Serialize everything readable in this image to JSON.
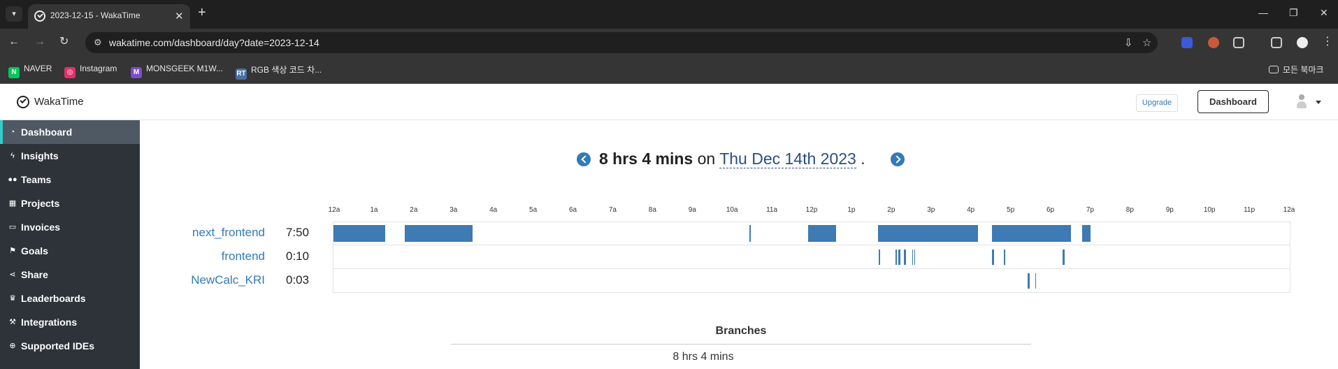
{
  "browser": {
    "tab_title": "2023-12-15 - WakaTime",
    "url": "wakatime.com/dashboard/day?date=2023-12-14",
    "bookmarks": [
      {
        "label": "NAVER",
        "icon": "naver-icon",
        "color": "#03c75a"
      },
      {
        "label": "Instagram",
        "icon": "instagram-icon",
        "color": "#e1306c"
      },
      {
        "label": "MONSGEEK M1W...",
        "icon": "monsgeek-icon",
        "color": "#7a4ccf"
      },
      {
        "label": "RGB 색상 코드 차...",
        "icon": "rt-icon",
        "color": "#4a6fa5"
      }
    ],
    "all_bookmarks": "모든 북마크"
  },
  "header": {
    "logo_text": "WakaTime",
    "upgrade_label": "Upgrade",
    "dashboard_label": "Dashboard"
  },
  "sidebar": {
    "items": [
      {
        "label": "Dashboard",
        "icon": "dashboard-icon",
        "active": true
      },
      {
        "label": "Insights",
        "icon": "bolt-icon"
      },
      {
        "label": "Teams",
        "icon": "users-icon"
      },
      {
        "label": "Projects",
        "icon": "grid-icon"
      },
      {
        "label": "Invoices",
        "icon": "file-icon"
      },
      {
        "label": "Goals",
        "icon": "flag-icon"
      },
      {
        "label": "Share",
        "icon": "share-icon"
      },
      {
        "label": "Leaderboards",
        "icon": "trophy-icon"
      },
      {
        "label": "Integrations",
        "icon": "wrench-icon"
      },
      {
        "label": "Supported IDEs",
        "icon": "plus-circle-icon"
      }
    ]
  },
  "summary": {
    "total": "8 hrs 4 mins",
    "on": "on",
    "date": "Thu Dec 14th 2023",
    "period": "."
  },
  "timeline": {
    "hours": [
      "12a",
      "1a",
      "2a",
      "3a",
      "4a",
      "5a",
      "6a",
      "7a",
      "8a",
      "9a",
      "10a",
      "11a",
      "12p",
      "1p",
      "2p",
      "3p",
      "4p",
      "5p",
      "6p",
      "7p",
      "8p",
      "9p",
      "10p",
      "11p",
      "12a"
    ],
    "accent": "#3e7ab3",
    "projects": [
      {
        "name": "next_frontend",
        "time": "7:50",
        "segments": [
          [
            0.0,
            1.3
          ],
          [
            1.78,
            3.48
          ],
          [
            10.42,
            10.45
          ],
          [
            11.9,
            12.6
          ],
          [
            13.64,
            16.16
          ],
          [
            16.5,
            18.48
          ],
          [
            18.76,
            18.98
          ]
        ]
      },
      {
        "name": "frontend",
        "time": "0:10",
        "segments": [
          [
            13.66,
            13.7
          ],
          [
            14.08,
            14.12
          ],
          [
            14.16,
            14.2
          ],
          [
            14.3,
            14.35
          ],
          [
            14.5,
            14.53
          ],
          [
            14.55,
            14.58
          ],
          [
            16.5,
            16.55
          ],
          [
            16.8,
            16.83
          ],
          [
            18.28,
            18.33
          ]
        ]
      },
      {
        "name": "NewCalc_KRI",
        "time": "0:03",
        "segments": [
          [
            17.4,
            17.45
          ],
          [
            17.58,
            17.6
          ]
        ]
      }
    ]
  },
  "branches": {
    "title": "Branches",
    "total": "8 hrs 4 mins"
  }
}
